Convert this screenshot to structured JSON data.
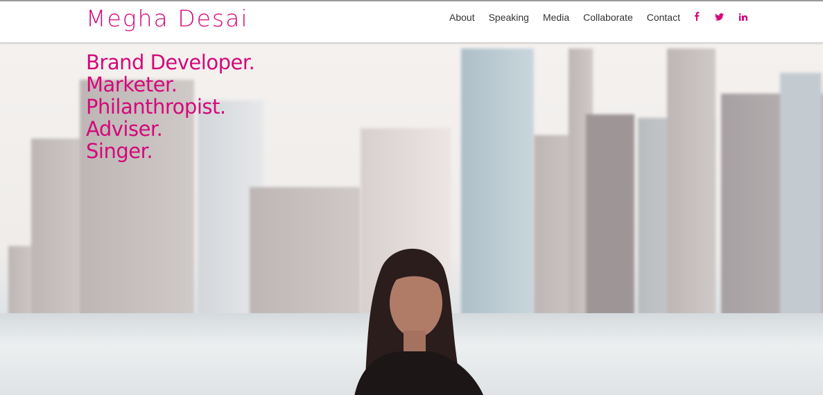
{
  "header": {
    "logo": "Megha Desai",
    "nav": [
      "About",
      "Speaking",
      "Media",
      "Collaborate",
      "Contact"
    ],
    "social": [
      {
        "icon": "facebook-icon",
        "glyph": "f"
      },
      {
        "icon": "twitter-icon",
        "glyph": "t"
      },
      {
        "icon": "linkedin-icon",
        "glyph": "in"
      }
    ]
  },
  "hero": {
    "taglines": [
      "Brand Developer.",
      "Marketer.",
      "Philanthropist.",
      "Adviser.",
      "Singer."
    ]
  },
  "colors": {
    "accent": "#d4087a",
    "nav_text": "#333333"
  }
}
